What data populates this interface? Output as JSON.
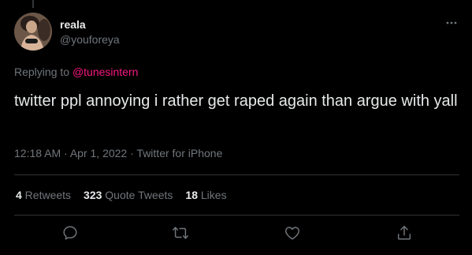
{
  "user": {
    "display_name": "reala",
    "handle": "@youforeya",
    "avatar_icon": "avatar-photo"
  },
  "reply": {
    "prefix": "Replying to ",
    "mention": "@tunesintern"
  },
  "tweet": {
    "text": "twitter ppl annoying i rather get raped again than argue with yall"
  },
  "meta": {
    "time": "12:18 AM",
    "separator1": " · ",
    "date": "Apr 1, 2022",
    "separator2": " · ",
    "source": "Twitter for iPhone"
  },
  "stats": {
    "retweets_count": "4",
    "retweets_label": " Retweets",
    "quotes_count": "323",
    "quotes_label": " Quote Tweets",
    "likes_count": "18",
    "likes_label": " Likes"
  },
  "actions": {
    "reply_icon": "reply-icon",
    "retweet_icon": "retweet-icon",
    "like_icon": "like-icon",
    "share_icon": "share-icon"
  },
  "colors": {
    "background": "#000000",
    "text": "#e7e9ea",
    "secondary": "#71767b",
    "mention": "#f91880",
    "divider": "#2f3336"
  }
}
